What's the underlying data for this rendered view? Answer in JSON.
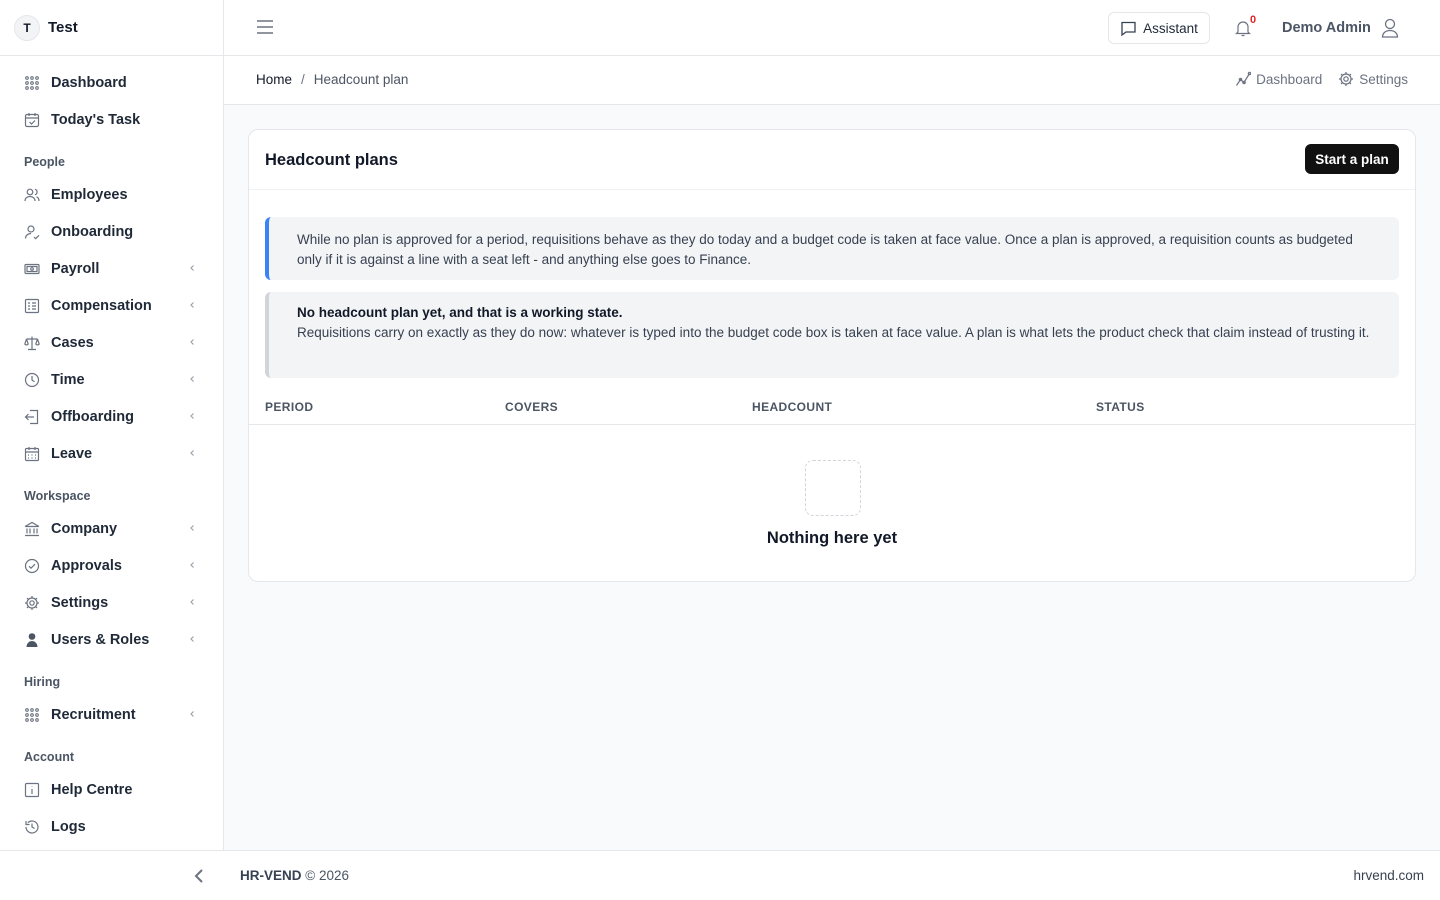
{
  "brand": {
    "initial": "T",
    "name": "Test"
  },
  "sidebar": {
    "top_items": [
      {
        "label": "Dashboard",
        "icon": "grid-dots-icon"
      },
      {
        "label": "Today's Task",
        "icon": "calendar-check-icon"
      }
    ],
    "sections": [
      {
        "title": "People",
        "items": [
          {
            "label": "Employees",
            "icon": "users-icon",
            "expandable": false
          },
          {
            "label": "Onboarding",
            "icon": "user-check-icon",
            "expandable": false
          },
          {
            "label": "Payroll",
            "icon": "cash-icon",
            "expandable": true
          },
          {
            "label": "Compensation",
            "icon": "list-details-icon",
            "expandable": true
          },
          {
            "label": "Cases",
            "icon": "scale-icon",
            "expandable": true
          },
          {
            "label": "Time",
            "icon": "clock-icon",
            "expandable": true
          },
          {
            "label": "Offboarding",
            "icon": "logout-icon",
            "expandable": true
          },
          {
            "label": "Leave",
            "icon": "calendar-icon",
            "expandable": true
          }
        ]
      },
      {
        "title": "Workspace",
        "items": [
          {
            "label": "Company",
            "icon": "building-bank-icon",
            "expandable": true
          },
          {
            "label": "Approvals",
            "icon": "circle-check-icon",
            "expandable": true
          },
          {
            "label": "Settings",
            "icon": "gear-icon",
            "expandable": true
          },
          {
            "label": "Users & Roles",
            "icon": "user-shield-icon",
            "expandable": true
          }
        ]
      },
      {
        "title": "Hiring",
        "items": [
          {
            "label": "Recruitment",
            "icon": "grid-dots-icon",
            "expandable": true
          }
        ]
      },
      {
        "title": "Account",
        "items": [
          {
            "label": "Help Centre",
            "icon": "info-square-icon",
            "expandable": false
          },
          {
            "label": "Logs",
            "icon": "history-icon",
            "expandable": false
          }
        ]
      }
    ]
  },
  "header": {
    "assistant_label": "Assistant",
    "notification_count": "0",
    "user_name": "Demo Admin"
  },
  "breadcrumb": {
    "home": "Home",
    "separator": "/",
    "current": "Headcount plan"
  },
  "quick_links": {
    "dashboard": "Dashboard",
    "settings": "Settings"
  },
  "card": {
    "title": "Headcount plans",
    "primary_button": "Start a plan",
    "info_notice": "While no plan is approved for a period, requisitions behave as they do today and a budget code is taken at face value. Once a plan is approved, a requisition counts as budgeted only if it is against a line with a seat left - and anything else goes to Finance.",
    "state_notice": {
      "title": "No headcount plan yet, and that is a working state.",
      "body": "Requisitions carry on exactly as they do now: whatever is typed into the budget code box is taken at face value. A plan is what lets the product check that claim instead of trusting it."
    },
    "table": {
      "columns": [
        "PERIOD",
        "COVERS",
        "HEADCOUNT",
        "STATUS"
      ],
      "rows": []
    },
    "empty_state": "Nothing here yet"
  },
  "footer": {
    "brand": "HR-VEND",
    "copyright": "© 2026",
    "site": "hrvend.com"
  },
  "colors": {
    "accent_blue": "#3b82f6",
    "primary_button": "#111111",
    "notification": "#dc2626",
    "page_background": "#f9fafb"
  }
}
